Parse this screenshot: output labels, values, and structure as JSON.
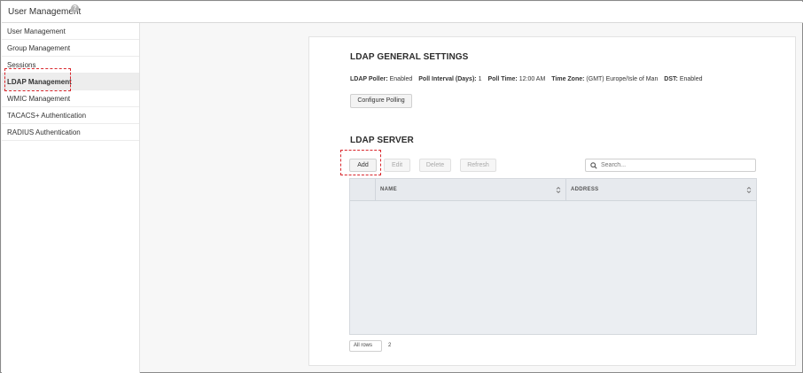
{
  "app": {
    "title": "User Management",
    "help_glyph": "?"
  },
  "sidebar": {
    "items": [
      {
        "label": "User Management"
      },
      {
        "label": "Group Management"
      },
      {
        "label": "Sessions"
      },
      {
        "label": "LDAP Management",
        "active": true
      },
      {
        "label": "WMIC Management"
      },
      {
        "label": "TACACS+ Authentication"
      },
      {
        "label": "RADIUS Authentication"
      }
    ]
  },
  "general": {
    "title": "LDAP GENERAL SETTINGS",
    "poller_label": "LDAP Poller:",
    "poller_value": "Enabled",
    "interval_label": "Poll Interval (Days):",
    "interval_value": "1",
    "time_label": "Poll Time:",
    "time_value": "12:00 AM",
    "zone_label": "Time Zone:",
    "zone_value": "(GMT) Europe/Isle of Man",
    "dst_label": "DST:",
    "dst_value": "Enabled",
    "configure_button": "Configure Polling"
  },
  "server": {
    "title": "LDAP SERVER",
    "buttons": {
      "add": "Add",
      "edit": "Edit",
      "delete": "Delete",
      "refresh": "Refresh"
    },
    "search_placeholder": "Search...",
    "columns": [
      "NAME",
      "ADDRESS"
    ],
    "rows": [],
    "page_size": "All rows",
    "total_count": "2"
  },
  "colors": {
    "callout": "#d9262c",
    "active_item_bg": "#ededed"
  }
}
